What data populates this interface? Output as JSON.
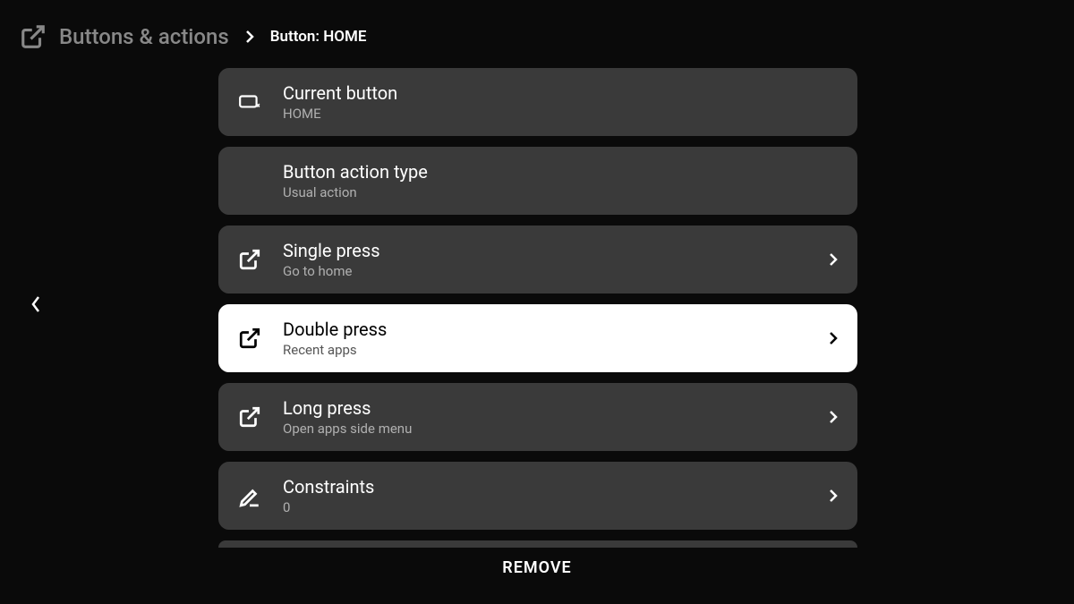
{
  "header": {
    "parent_label": "Buttons & actions",
    "current_label": "Button: HOME"
  },
  "items": [
    {
      "title": "Current button",
      "subtitle": "HOME",
      "icon": "device",
      "chevron": false
    },
    {
      "title": "Button action type",
      "subtitle": "Usual action",
      "icon": "dpad",
      "chevron": false
    },
    {
      "title": "Single press",
      "subtitle": "Go to home",
      "icon": "external",
      "chevron": true
    },
    {
      "title": "Double press",
      "subtitle": "Recent apps",
      "icon": "external",
      "chevron": true,
      "selected": true
    },
    {
      "title": "Long press",
      "subtitle": "Open apps side menu",
      "icon": "external",
      "chevron": true
    },
    {
      "title": "Constraints",
      "subtitle": "0",
      "icon": "edit",
      "chevron": true
    }
  ],
  "remove_label": "REMOVE"
}
